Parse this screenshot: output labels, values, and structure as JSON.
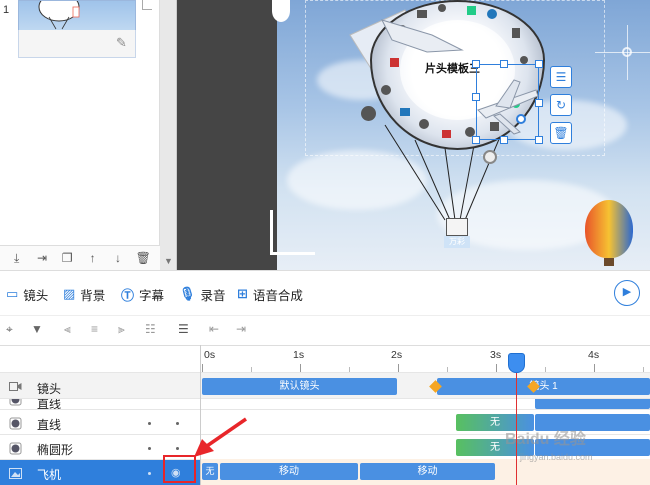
{
  "slides": {
    "items": [
      {
        "number": "1"
      }
    ]
  },
  "canvas": {
    "balloon_title": "片头模板三",
    "basket_label": "万彩"
  },
  "track_toolbar": {
    "items": [
      {
        "label": "镜头",
        "icon": "camera-icon"
      },
      {
        "label": "背景",
        "icon": "background-icon"
      },
      {
        "label": "字幕",
        "icon": "subtitle-icon"
      },
      {
        "label": "录音",
        "icon": "microphone-icon"
      },
      {
        "label": "语音合成",
        "icon": "tts-icon"
      }
    ]
  },
  "timeline": {
    "ticks": [
      "0s",
      "1s",
      "2s",
      "3s",
      "4s"
    ],
    "rows": [
      {
        "name": "镜头",
        "bars": [
          {
            "label": "默认镜头"
          },
          {
            "label": "镜头 1"
          }
        ]
      },
      {
        "name": "直线",
        "bars": [
          {
            "label": ""
          }
        ]
      },
      {
        "name": "直线",
        "bars": [
          {
            "label": "无"
          }
        ]
      },
      {
        "name": "椭圆形",
        "bars": [
          {
            "label": "无"
          }
        ]
      },
      {
        "name": "飞机",
        "bars": [
          {
            "label": "无"
          },
          {
            "label": "移动"
          },
          {
            "label": "移动"
          }
        ]
      }
    ]
  },
  "watermark": {
    "text": "Baidu 经验",
    "url": "jingyan.baidu.com"
  },
  "colors": {
    "accent": "#2f7fdc",
    "bar": "#4a90e2",
    "playhead": "#e03030",
    "annotation": "#e8262a",
    "keyframe": "#f5a623"
  }
}
